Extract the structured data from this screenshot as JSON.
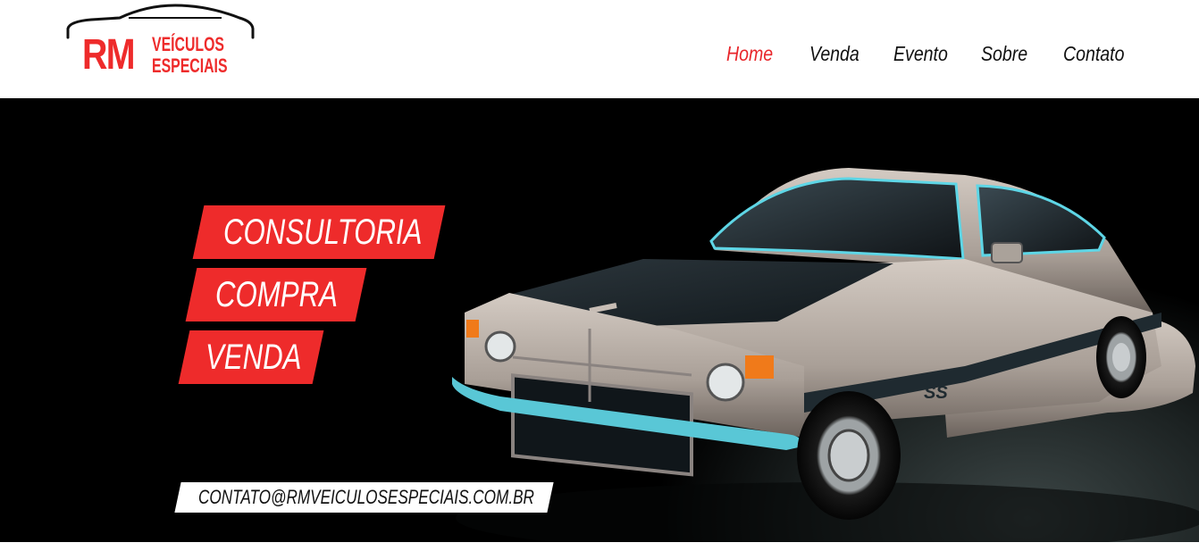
{
  "logo": {
    "initials": "RM",
    "line1": "VEÍCULOS",
    "line2": "ESPECIAIS"
  },
  "nav": {
    "items": [
      {
        "label": "Home",
        "active": true
      },
      {
        "label": "Venda",
        "active": false
      },
      {
        "label": "Evento",
        "active": false
      },
      {
        "label": "Sobre",
        "active": false
      },
      {
        "label": "Contato",
        "active": false
      }
    ]
  },
  "hero": {
    "tags": [
      "CONSULTORIA",
      "COMPRA",
      "VENDA"
    ],
    "email": "CONTATO@RMVEICULOSESPECIAIS.COM.BR",
    "car_badge": "SS"
  },
  "colors": {
    "accent": "#ee2b2b",
    "nav_active": "#e8262b",
    "nav_text": "#111111",
    "hero_bg": "#000000",
    "car_body": "#b7aea6",
    "car_stripe": "#1f2a30",
    "car_trim": "#5ed6e6"
  }
}
